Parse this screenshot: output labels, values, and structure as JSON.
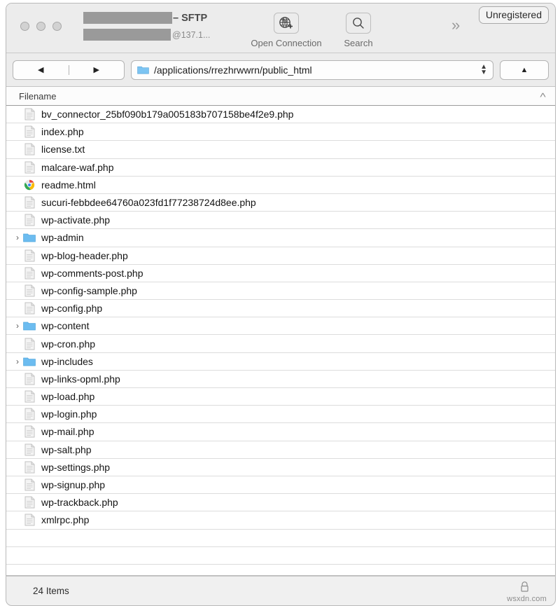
{
  "window": {
    "title_suffix": "– SFTP",
    "title_host": "@137.1...",
    "title_redacted": true
  },
  "titlebar": {
    "traffic_lights": [
      "close",
      "minimize",
      "zoom"
    ],
    "overflow_label": "»",
    "unregistered_badge": "Unregistered",
    "buttons": [
      {
        "id": "open-connection",
        "label": "Open Connection",
        "icon": "globe-plus-icon"
      },
      {
        "id": "search",
        "label": "Search",
        "icon": "magnifier-icon"
      }
    ]
  },
  "pathbar": {
    "back_label": "◀",
    "forward_label": "▶",
    "folder_icon": "folder-icon",
    "path_value": "/applications/rrezhrwwrn/public_html",
    "stepper_icon": "updown-stepper-icon",
    "updir_label": "▲"
  },
  "columns": {
    "filename_header": "Filename",
    "sort_indicator": "˄"
  },
  "files": [
    {
      "name": "bv_connector_25bf090b179a005183b707158be4f2e9.php",
      "type": "file",
      "icon": "document-icon",
      "expandable": false
    },
    {
      "name": "index.php",
      "type": "file",
      "icon": "document-icon",
      "expandable": false
    },
    {
      "name": "license.txt",
      "type": "file",
      "icon": "document-icon",
      "expandable": false
    },
    {
      "name": "malcare-waf.php",
      "type": "file",
      "icon": "document-icon",
      "expandable": false
    },
    {
      "name": "readme.html",
      "type": "file",
      "icon": "chrome-icon",
      "expandable": false
    },
    {
      "name": "sucuri-febbdee64760a023fd1f77238724d8ee.php",
      "type": "file",
      "icon": "document-icon",
      "expandable": false
    },
    {
      "name": "wp-activate.php",
      "type": "file",
      "icon": "document-icon",
      "expandable": false
    },
    {
      "name": "wp-admin",
      "type": "folder",
      "icon": "folder-icon",
      "expandable": true
    },
    {
      "name": "wp-blog-header.php",
      "type": "file",
      "icon": "document-icon",
      "expandable": false
    },
    {
      "name": "wp-comments-post.php",
      "type": "file",
      "icon": "document-icon",
      "expandable": false
    },
    {
      "name": "wp-config-sample.php",
      "type": "file",
      "icon": "document-icon",
      "expandable": false
    },
    {
      "name": "wp-config.php",
      "type": "file",
      "icon": "document-icon",
      "expandable": false
    },
    {
      "name": "wp-content",
      "type": "folder",
      "icon": "folder-icon",
      "expandable": true
    },
    {
      "name": "wp-cron.php",
      "type": "file",
      "icon": "document-icon",
      "expandable": false
    },
    {
      "name": "wp-includes",
      "type": "folder",
      "icon": "folder-icon",
      "expandable": true
    },
    {
      "name": "wp-links-opml.php",
      "type": "file",
      "icon": "document-icon",
      "expandable": false
    },
    {
      "name": "wp-load.php",
      "type": "file",
      "icon": "document-icon",
      "expandable": false
    },
    {
      "name": "wp-login.php",
      "type": "file",
      "icon": "document-icon",
      "expandable": false
    },
    {
      "name": "wp-mail.php",
      "type": "file",
      "icon": "document-icon",
      "expandable": false
    },
    {
      "name": "wp-salt.php",
      "type": "file",
      "icon": "document-icon",
      "expandable": false
    },
    {
      "name": "wp-settings.php",
      "type": "file",
      "icon": "document-icon",
      "expandable": false
    },
    {
      "name": "wp-signup.php",
      "type": "file",
      "icon": "document-icon",
      "expandable": false
    },
    {
      "name": "wp-trackback.php",
      "type": "file",
      "icon": "document-icon",
      "expandable": false
    },
    {
      "name": "xmlrpc.php",
      "type": "file",
      "icon": "document-icon",
      "expandable": false
    }
  ],
  "empty_rows": 2,
  "statusbar": {
    "item_count_label": "24 Items",
    "lock_icon": "padlock-icon"
  },
  "watermark": "wsxdn.com",
  "colors": {
    "chrome_bg": "#ececec",
    "folder_blue": "#6cbcf0",
    "accent_text": "#141414",
    "disclosure_gray": "#5a5a5a"
  }
}
